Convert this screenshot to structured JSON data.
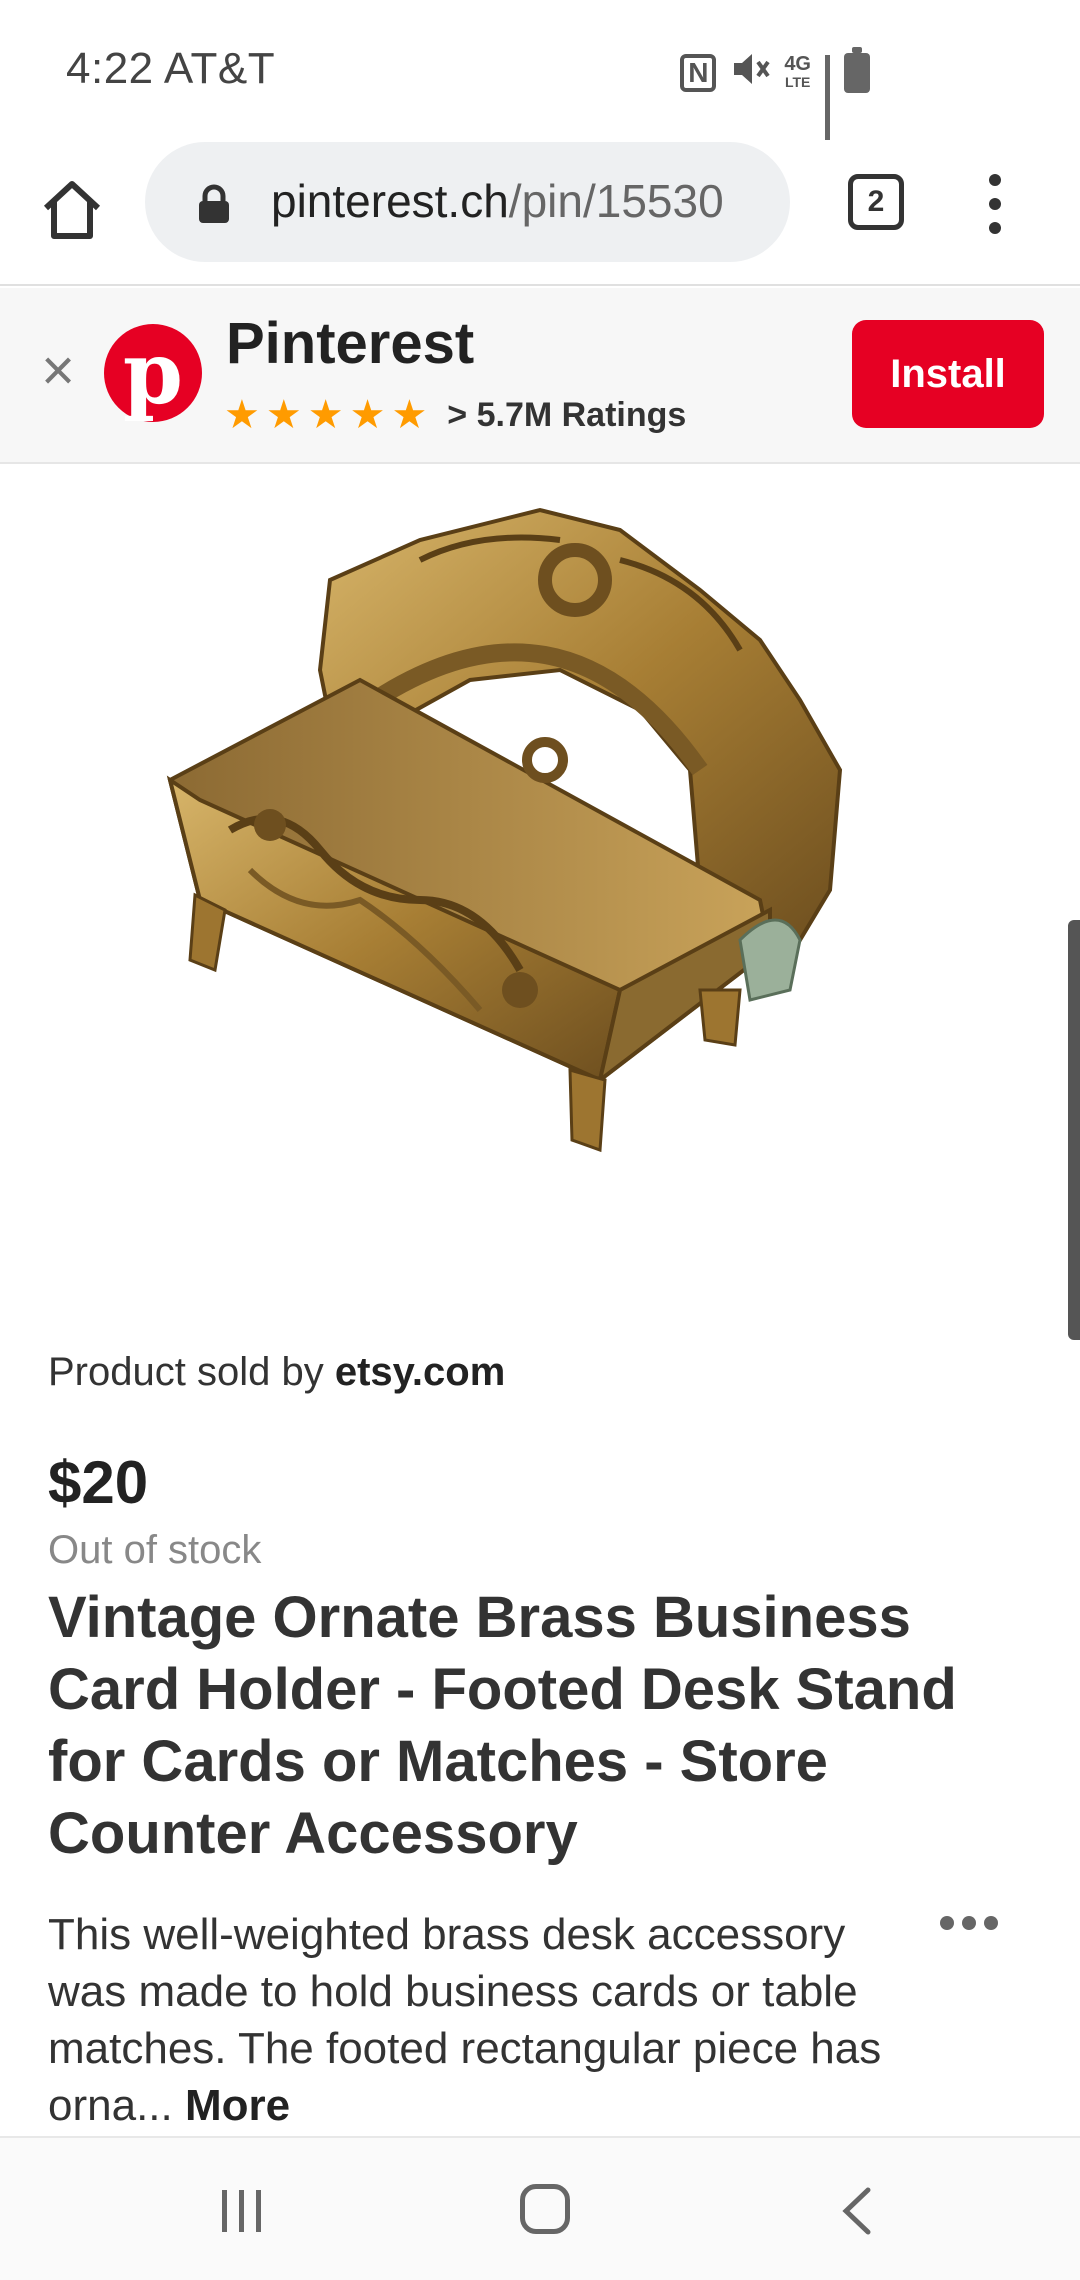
{
  "status_bar": {
    "time_carrier": "4:22 AT&T",
    "icons": [
      "nfc-icon",
      "mute-icon",
      "4g-lte-icon",
      "signal-icon",
      "battery-icon"
    ],
    "lte_top": "4G",
    "lte_bottom": "LTE",
    "nfc_glyph": "N"
  },
  "browser": {
    "url_domain": "pinterest.ch",
    "url_path": "/pin/15530",
    "tab_count": "2"
  },
  "app_banner": {
    "close_glyph": "×",
    "logo_glyph": "p",
    "app_name": "Pinterest",
    "stars": "★★★★★",
    "rating_text": "> 5.7M Ratings",
    "install_label": "Install",
    "brand_color": "#e60023",
    "star_color": "#ff9b00"
  },
  "product": {
    "image_alt": "Vintage ornate brass business card holder",
    "sold_by_prefix": "Product sold by ",
    "sold_by_site": "etsy.com",
    "price": "$20",
    "stock_status": "Out of stock",
    "title": "Vintage Ornate Brass Business Card Holder - Footed Desk Stand for Cards or Matches - Store Counter Accessory",
    "description": "This well-weighted brass desk accessory was made to hold business cards or table matches. The footed rectangular piece has orna... ",
    "more_label": "More"
  },
  "nav_bar": {
    "buttons": [
      "recent-apps",
      "home",
      "back"
    ]
  }
}
